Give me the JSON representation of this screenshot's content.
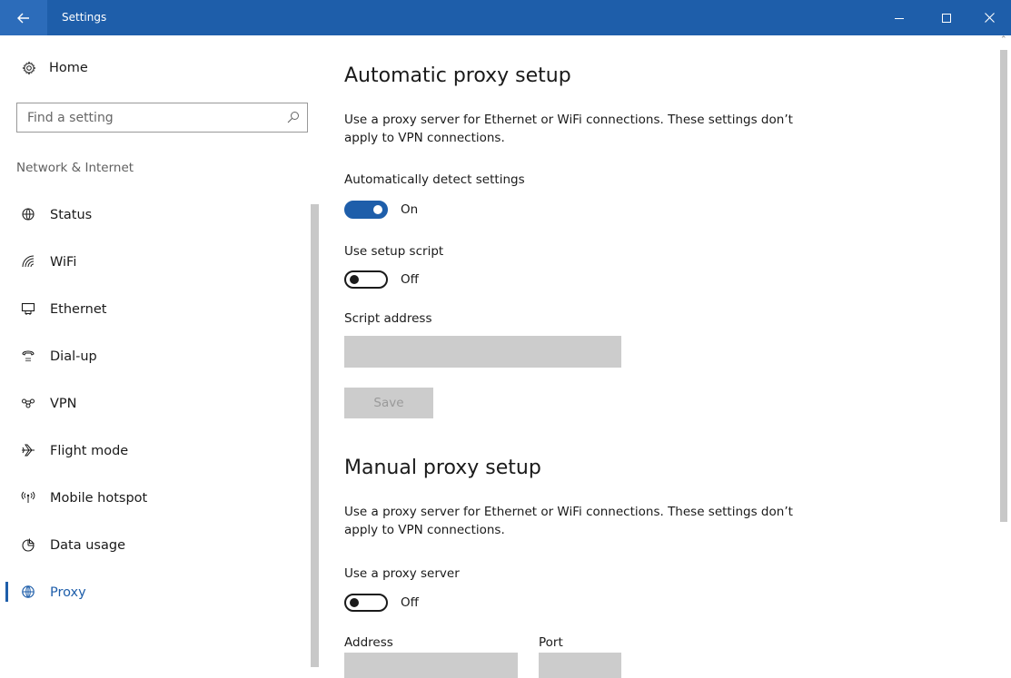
{
  "window": {
    "title": "Settings"
  },
  "sidebar": {
    "home_label": "Home",
    "search_placeholder": "Find a setting",
    "section_title": "Network & Internet",
    "items": [
      {
        "label": "Status",
        "icon": "globe-status-icon"
      },
      {
        "label": "WiFi",
        "icon": "wifi-icon"
      },
      {
        "label": "Ethernet",
        "icon": "ethernet-icon"
      },
      {
        "label": "Dial-up",
        "icon": "dialup-icon"
      },
      {
        "label": "VPN",
        "icon": "vpn-icon"
      },
      {
        "label": "Flight mode",
        "icon": "airplane-icon"
      },
      {
        "label": "Mobile hotspot",
        "icon": "hotspot-icon"
      },
      {
        "label": "Data usage",
        "icon": "data-usage-icon"
      },
      {
        "label": "Proxy",
        "icon": "globe-icon",
        "active": true
      }
    ]
  },
  "automatic": {
    "heading": "Automatic proxy setup",
    "description": "Use a proxy server for Ethernet or WiFi connections. These settings don’t apply to VPN connections.",
    "detect_label": "Automatically detect settings",
    "detect_state": "On",
    "script_label": "Use setup script",
    "script_state": "Off",
    "address_label": "Script address",
    "address_value": "",
    "save_label": "Save"
  },
  "manual": {
    "heading": "Manual proxy setup",
    "description": "Use a proxy server for Ethernet or WiFi connections. These settings don’t apply to VPN connections.",
    "use_label": "Use a proxy server",
    "use_state": "Off",
    "address_label": "Address",
    "port_label": "Port",
    "address_value": "",
    "port_value": ""
  },
  "colors": {
    "accent": "#1e5eaa",
    "field": "#cccccc"
  }
}
